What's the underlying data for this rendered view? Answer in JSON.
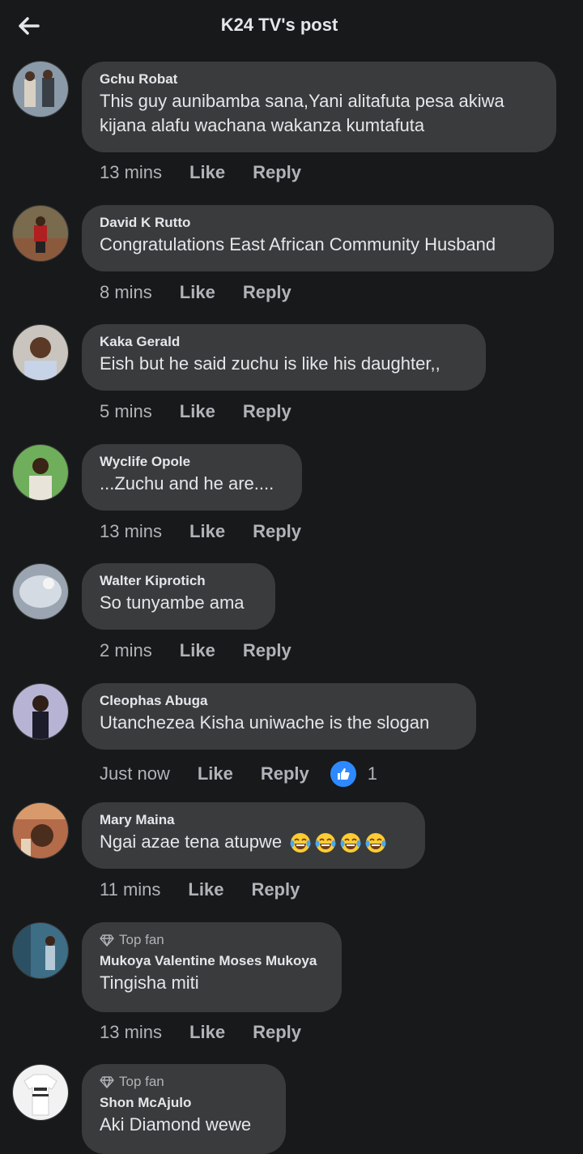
{
  "header": {
    "title": "K24 TV's post",
    "back_icon": "arrow-left-icon"
  },
  "comments": [
    {
      "author": "Gchu Robat",
      "text": "This guy aunibamba sana,Yani alitafuta pesa akiwa kijana alafu wachana wakanza kumtafuta",
      "time": "13 mins",
      "like": "Like",
      "reply": "Reply"
    },
    {
      "author": "David K Rutto",
      "text": "Congratulations East African Community Husband",
      "time": "8 mins",
      "like": "Like",
      "reply": "Reply"
    },
    {
      "author": "Kaka Gerald",
      "text": "Eish but he said zuchu is like his daughter,,",
      "time": "5 mins",
      "like": "Like",
      "reply": "Reply"
    },
    {
      "author": "Wyclife Opole",
      "text": "...Zuchu and he are....",
      "time": "13 mins",
      "like": "Like",
      "reply": "Reply"
    },
    {
      "author": "Walter Kiprotich",
      "text": "So tunyambe ama",
      "time": "2 mins",
      "like": "Like",
      "reply": "Reply"
    },
    {
      "author": "Cleophas Abuga",
      "text": "Utanchezea Kisha uniwache is the slogan",
      "time": "Just now",
      "like": "Like",
      "reply": "Reply",
      "reaction_count": "1",
      "reaction_icon": "thumbs-up-icon"
    },
    {
      "author": "Mary Maina",
      "text": "Ngai azae tena atupwe",
      "emoji_count": 4,
      "emoji_icon": "tears-of-joy-emoji",
      "time": "11 mins",
      "like": "Like",
      "reply": "Reply"
    },
    {
      "badge": "Top fan",
      "badge_icon": "diamond-icon",
      "author": "Mukoya Valentine Moses Mukoya",
      "text": "Tingisha miti",
      "time": "13 mins",
      "like": "Like",
      "reply": "Reply"
    },
    {
      "badge": "Top fan",
      "badge_icon": "diamond-icon",
      "author": "Shon McAjulo",
      "text": "Aki Diamond wewe"
    }
  ],
  "colors": {
    "background": "#18191a",
    "bubble": "#3a3b3c",
    "text": "#e4e6eb",
    "muted": "#b0b3b8",
    "accent": "#2e89ff"
  }
}
